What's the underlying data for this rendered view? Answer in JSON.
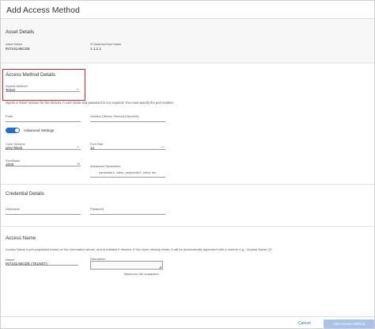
{
  "dialog": {
    "title": "Add Access Method"
  },
  "asset": {
    "section_title": "Asset Details",
    "asset_name_label": "Asset Name",
    "asset_name_value": "INT101ABCDE",
    "ip_label": "IP Address/Host Name",
    "ip_value": "1.1.1.1"
  },
  "access_method": {
    "section_title": "Access Method Details",
    "method_label": "Access Method*",
    "method_value": "Telnet",
    "hint": "Opens a Telnet session for the devices. A user name and password is not required. You must specify the port number.",
    "ports_label": "Ports",
    "session_label": "Session (Telnet) Timeout (Seconds)",
    "advanced_label": "Advanced Settings",
    "color_scheme_label": "Color Scheme",
    "color_scheme_value": "grey-black",
    "font_size_label": "Font Size",
    "font_size_value": "12",
    "scrollback_label": "Scrollback",
    "scrollback_value": "1000",
    "scrollback_unit": "%",
    "adv_params_label": "Advanced Parameters",
    "adv_params_placeholder": "parameter1: value, parameter2: value, etc."
  },
  "credential": {
    "section_title": "Credential Details",
    "username_label": "Username",
    "password_label": "Password"
  },
  "access_name": {
    "section_title": "Access Name",
    "hint": "Access Name is pre-populated based on the information above, and is editable if desired. If the name already exists, it will be automatically appended with a number e.g., 'Access Name (2)'.",
    "name_label": "Name*",
    "name_value": "INT101ABCDE (TELNET)",
    "desc_label": "Description",
    "desc_counter": "Maximum 150 characters"
  },
  "footer": {
    "cancel": "Cancel",
    "add": "Add Access Method"
  },
  "colors": {
    "accent": "#1d6fd6",
    "highlight": "#d9232e",
    "disabled_button": "#a7c3e8"
  },
  "icons": {
    "dropdown": "chevron-down-icon",
    "resize": "resize-handle-icon"
  }
}
